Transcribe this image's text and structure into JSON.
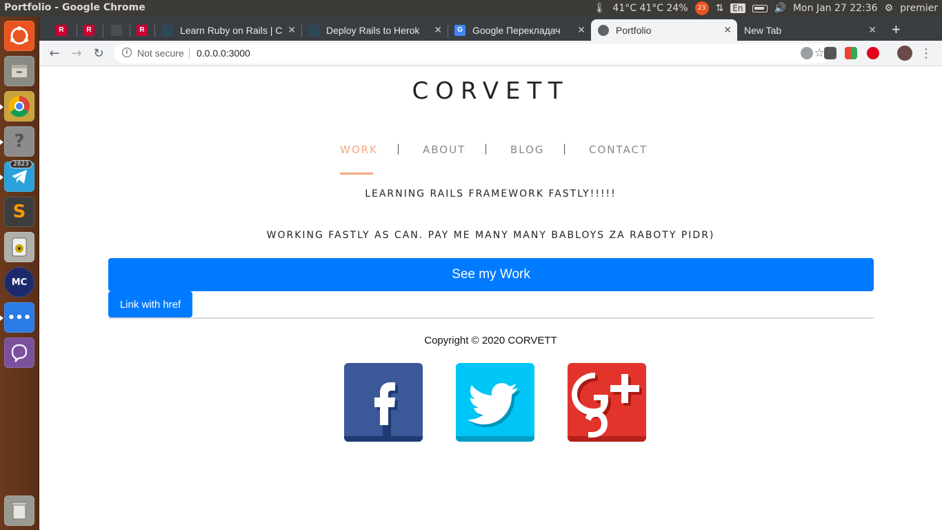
{
  "os_panel": {
    "window_title": "Portfolio - Google Chrome",
    "temperature": "41°C 41°C 24%",
    "notifications_badge": "23",
    "keyboard_layout": "En",
    "datetime": "Mon Jan 27 22:36",
    "user": "premier"
  },
  "launcher": {
    "telegram_badge": "2823"
  },
  "browser": {
    "tabs": [
      {
        "label": ""
      },
      {
        "label": ""
      },
      {
        "label": ""
      },
      {
        "label": ""
      },
      {
        "label": "Learn Ruby on Rails | C"
      },
      {
        "label": "Deploy Rails to Herok"
      },
      {
        "label": "Google Перекладач"
      },
      {
        "label": "Portfolio"
      },
      {
        "label": "New Tab"
      }
    ],
    "security_label": "Not secure",
    "url": "0.0.0.0:3000"
  },
  "page": {
    "brand": "CORVETT",
    "nav": [
      {
        "label": "WORK"
      },
      {
        "label": "ABOUT"
      },
      {
        "label": "BLOG"
      },
      {
        "label": "CONTACT"
      }
    ],
    "nav_separator": "|",
    "tagline": "LEARNING RAILS FRAMEWORK FASTLY!!!!!",
    "subtagline": "WORKING FASTLY AS CAN. PAY ME MANY MANY BABLOYS ZA RABOTY PIDR)",
    "primary_button": "See my Work",
    "secondary_button": "Link with href",
    "copyright": "Copyright © 2020 CORVETT"
  },
  "colors": {
    "accent": "#f4a980",
    "button_blue": "#007bff",
    "facebook": "#3b5998",
    "twitter": "#00c6f7",
    "google_plus": "#e2342c"
  }
}
